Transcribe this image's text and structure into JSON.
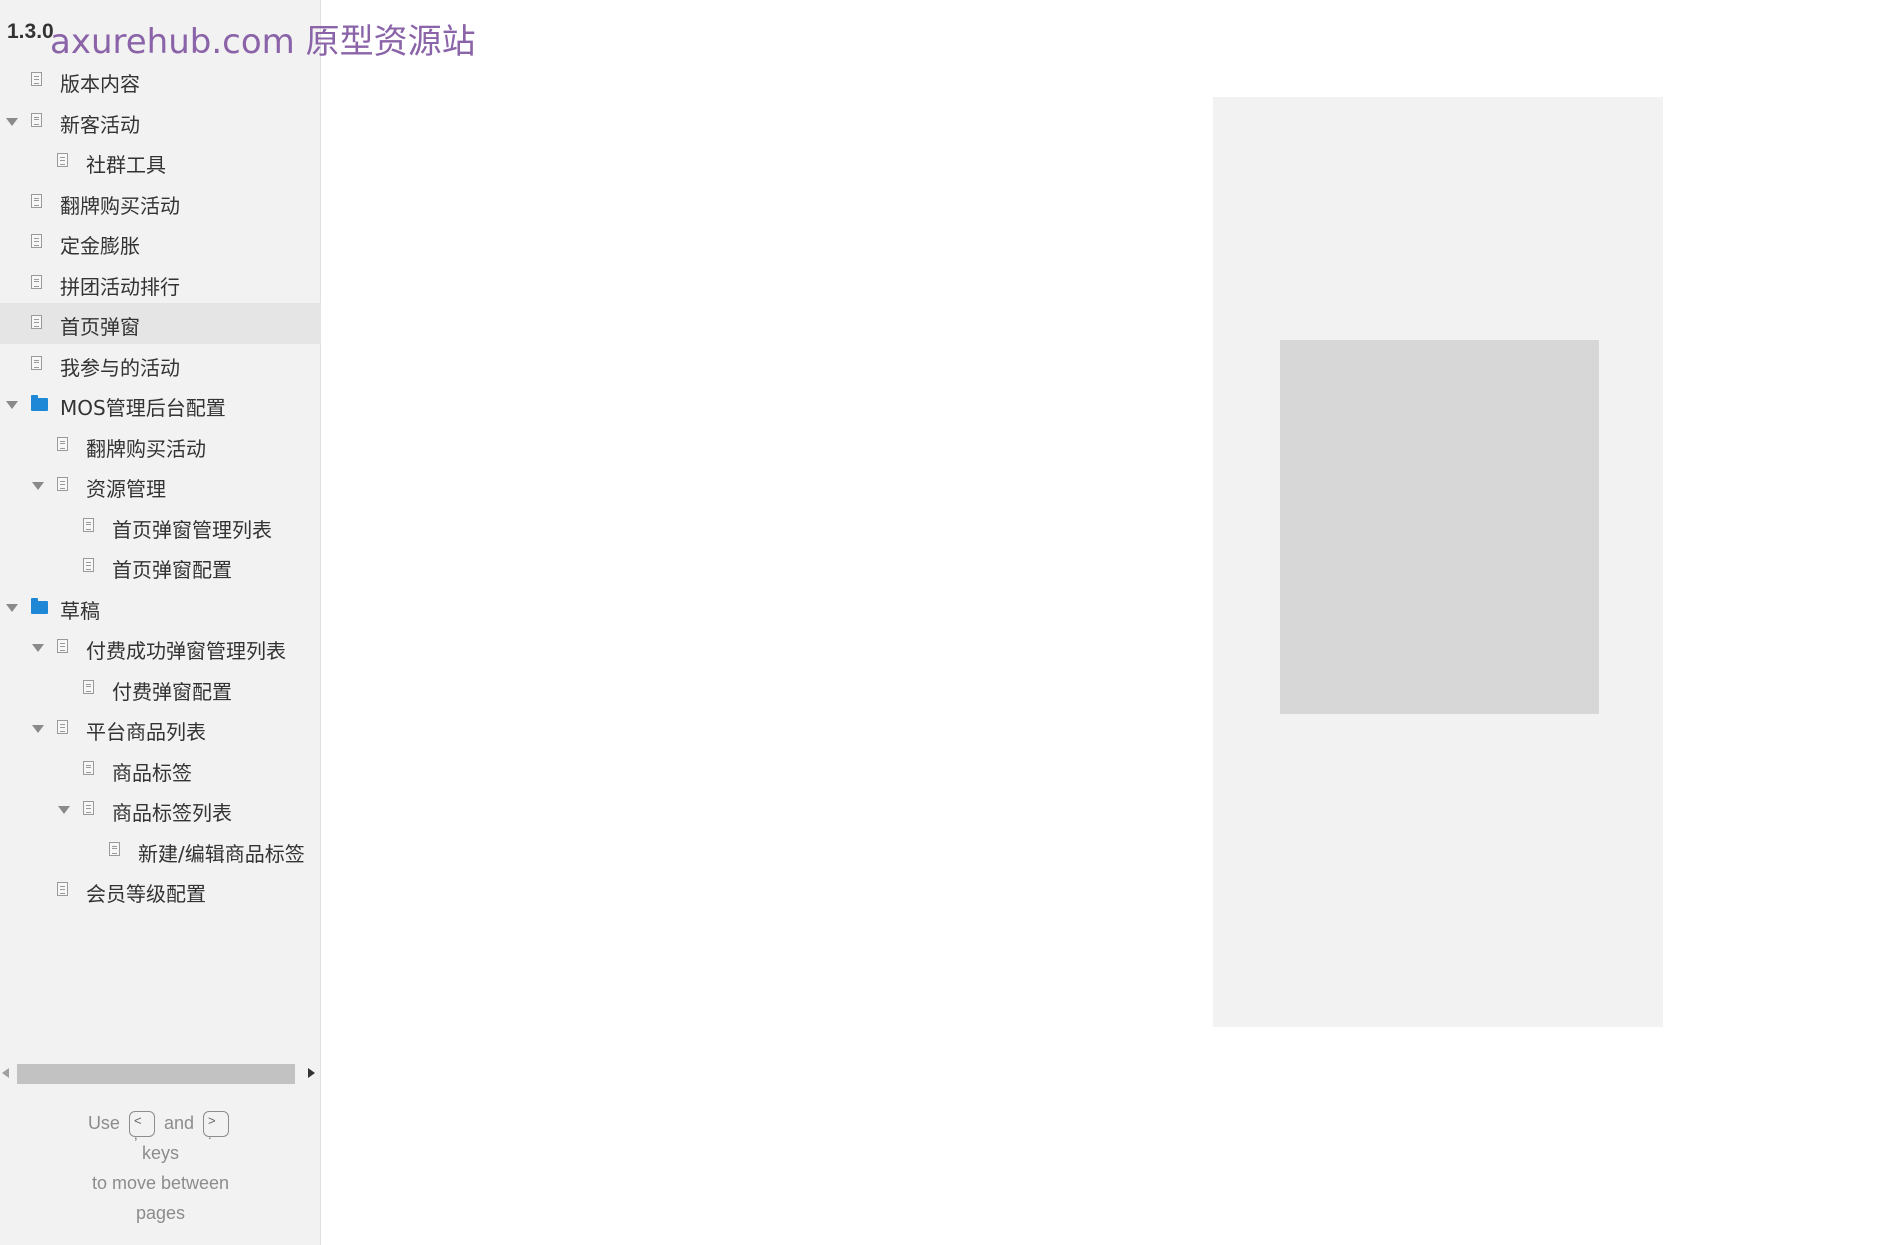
{
  "sidebar": {
    "version": "1.3.0",
    "watermark": "axurehub.com 原型资源站",
    "tree": [
      {
        "label": "版本内容",
        "icon": "page-icon",
        "level": 1,
        "caret": false
      },
      {
        "label": "新客活动",
        "icon": "page-icon",
        "level": 1,
        "caret": true
      },
      {
        "label": "社群工具",
        "icon": "page-icon",
        "level": 2,
        "caret": false
      },
      {
        "label": "翻牌购买活动",
        "icon": "page-icon",
        "level": 1,
        "caret": false
      },
      {
        "label": "定金膨胀",
        "icon": "page-icon",
        "level": 1,
        "caret": false
      },
      {
        "label": "拼团活动排行",
        "icon": "page-icon",
        "level": 1,
        "caret": false
      },
      {
        "label": "首页弹窗",
        "icon": "page-icon",
        "level": 1,
        "caret": false,
        "selected": true
      },
      {
        "label": "我参与的活动",
        "icon": "page-icon",
        "level": 1,
        "caret": false
      },
      {
        "label": "MOS管理后台配置",
        "icon": "folder-icon",
        "level": 1,
        "caret": true
      },
      {
        "label": "翻牌购买活动",
        "icon": "page-icon",
        "level": 2,
        "caret": false
      },
      {
        "label": "资源管理",
        "icon": "page-icon",
        "level": 2,
        "caret": true
      },
      {
        "label": "首页弹窗管理列表",
        "icon": "page-icon",
        "level": 3,
        "caret": false
      },
      {
        "label": "首页弹窗配置",
        "icon": "page-icon",
        "level": 3,
        "caret": false
      },
      {
        "label": "草稿",
        "icon": "folder-icon",
        "level": 1,
        "caret": true
      },
      {
        "label": "付费成功弹窗管理列表",
        "icon": "page-icon",
        "level": 2,
        "caret": true
      },
      {
        "label": "付费弹窗配置",
        "icon": "page-icon",
        "level": 3,
        "caret": false
      },
      {
        "label": "平台商品列表",
        "icon": "page-icon",
        "level": 2,
        "caret": true
      },
      {
        "label": "商品标签",
        "icon": "page-icon",
        "level": 3,
        "caret": false
      },
      {
        "label": "商品标签列表",
        "icon": "page-icon",
        "level": 3,
        "caret": true
      },
      {
        "label": "新建/编辑商品标签",
        "icon": "page-icon",
        "level": 4,
        "caret": false
      },
      {
        "label": "会员等级配置",
        "icon": "page-icon",
        "level": 2,
        "caret": false
      }
    ],
    "help": {
      "use": "Use",
      "prev_key": "<\n,",
      "and": "and",
      "next_key": ">\n.",
      "keys": "keys",
      "line2": "to move between",
      "line3": "pages"
    }
  }
}
